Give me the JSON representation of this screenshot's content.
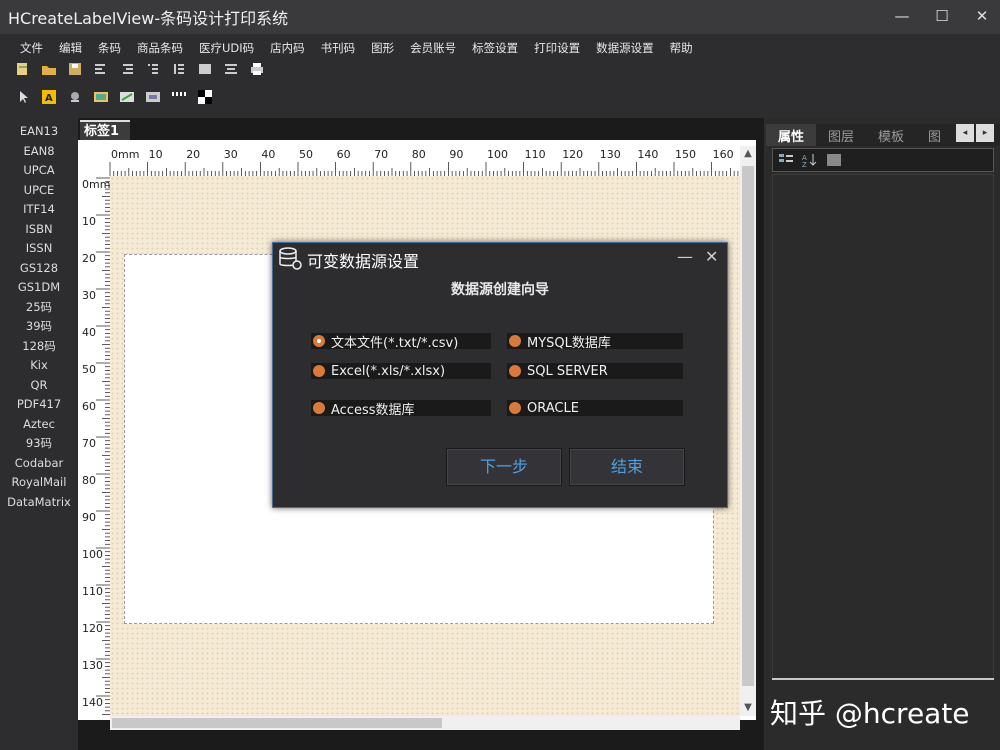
{
  "window": {
    "title": "HCreateLabelView-条码设计打印系统",
    "minimize": "—",
    "maximize": "☐",
    "close": "✕"
  },
  "menu": [
    "文件",
    "编辑",
    "条码",
    "商品条码",
    "医疗UDI码",
    "店内码",
    "书刊码",
    "图形",
    "会员账号",
    "标签设置",
    "打印设置",
    "数据源设置",
    "帮助"
  ],
  "sidebar": [
    "EAN13",
    "EAN8",
    "UPCA",
    "UPCE",
    "ITF14",
    "ISBN",
    "ISSN",
    "GS128",
    "GS1DM",
    "25码",
    "39码",
    "128码",
    "Kix",
    "QR",
    "PDF417",
    "Aztec",
    "93码",
    "Codabar",
    "RoyalMail",
    "DataMatrix"
  ],
  "document": {
    "tab_label": "标签1",
    "ruler_h": [
      "0mm",
      "10",
      "20",
      "30",
      "40",
      "50",
      "60",
      "70",
      "80",
      "90",
      "100",
      "110",
      "120",
      "130",
      "140",
      "150",
      "160"
    ],
    "ruler_v": [
      "0mm",
      "10",
      "20",
      "30",
      "40",
      "50",
      "60",
      "70",
      "80",
      "90",
      "100",
      "110",
      "120",
      "130",
      "140"
    ]
  },
  "right_panel": {
    "tabs": [
      "属性",
      "图层",
      "模板",
      "图"
    ],
    "active_tab": "属性",
    "prev": "◂",
    "next": "▸"
  },
  "dialog": {
    "title": "可变数据源设置",
    "heading": "数据源创建向导",
    "options": [
      {
        "label": "文本文件(*.txt/*.csv)",
        "selected": true
      },
      {
        "label": "MYSQL数据库",
        "selected": false
      },
      {
        "label": "Excel(*.xls/*.xlsx)",
        "selected": false
      },
      {
        "label": "SQL SERVER",
        "selected": false
      },
      {
        "label": "Access数据库",
        "selected": false
      },
      {
        "label": "ORACLE",
        "selected": false
      }
    ],
    "next_button": "下一步",
    "finish_button": "结束",
    "minimize": "—",
    "close": "✕"
  },
  "watermark": "知乎 @hcreate",
  "colors": {
    "radio": "#d87a3a",
    "button_text": "#4ea0e0",
    "canvas_bg": "#f4ead6"
  }
}
